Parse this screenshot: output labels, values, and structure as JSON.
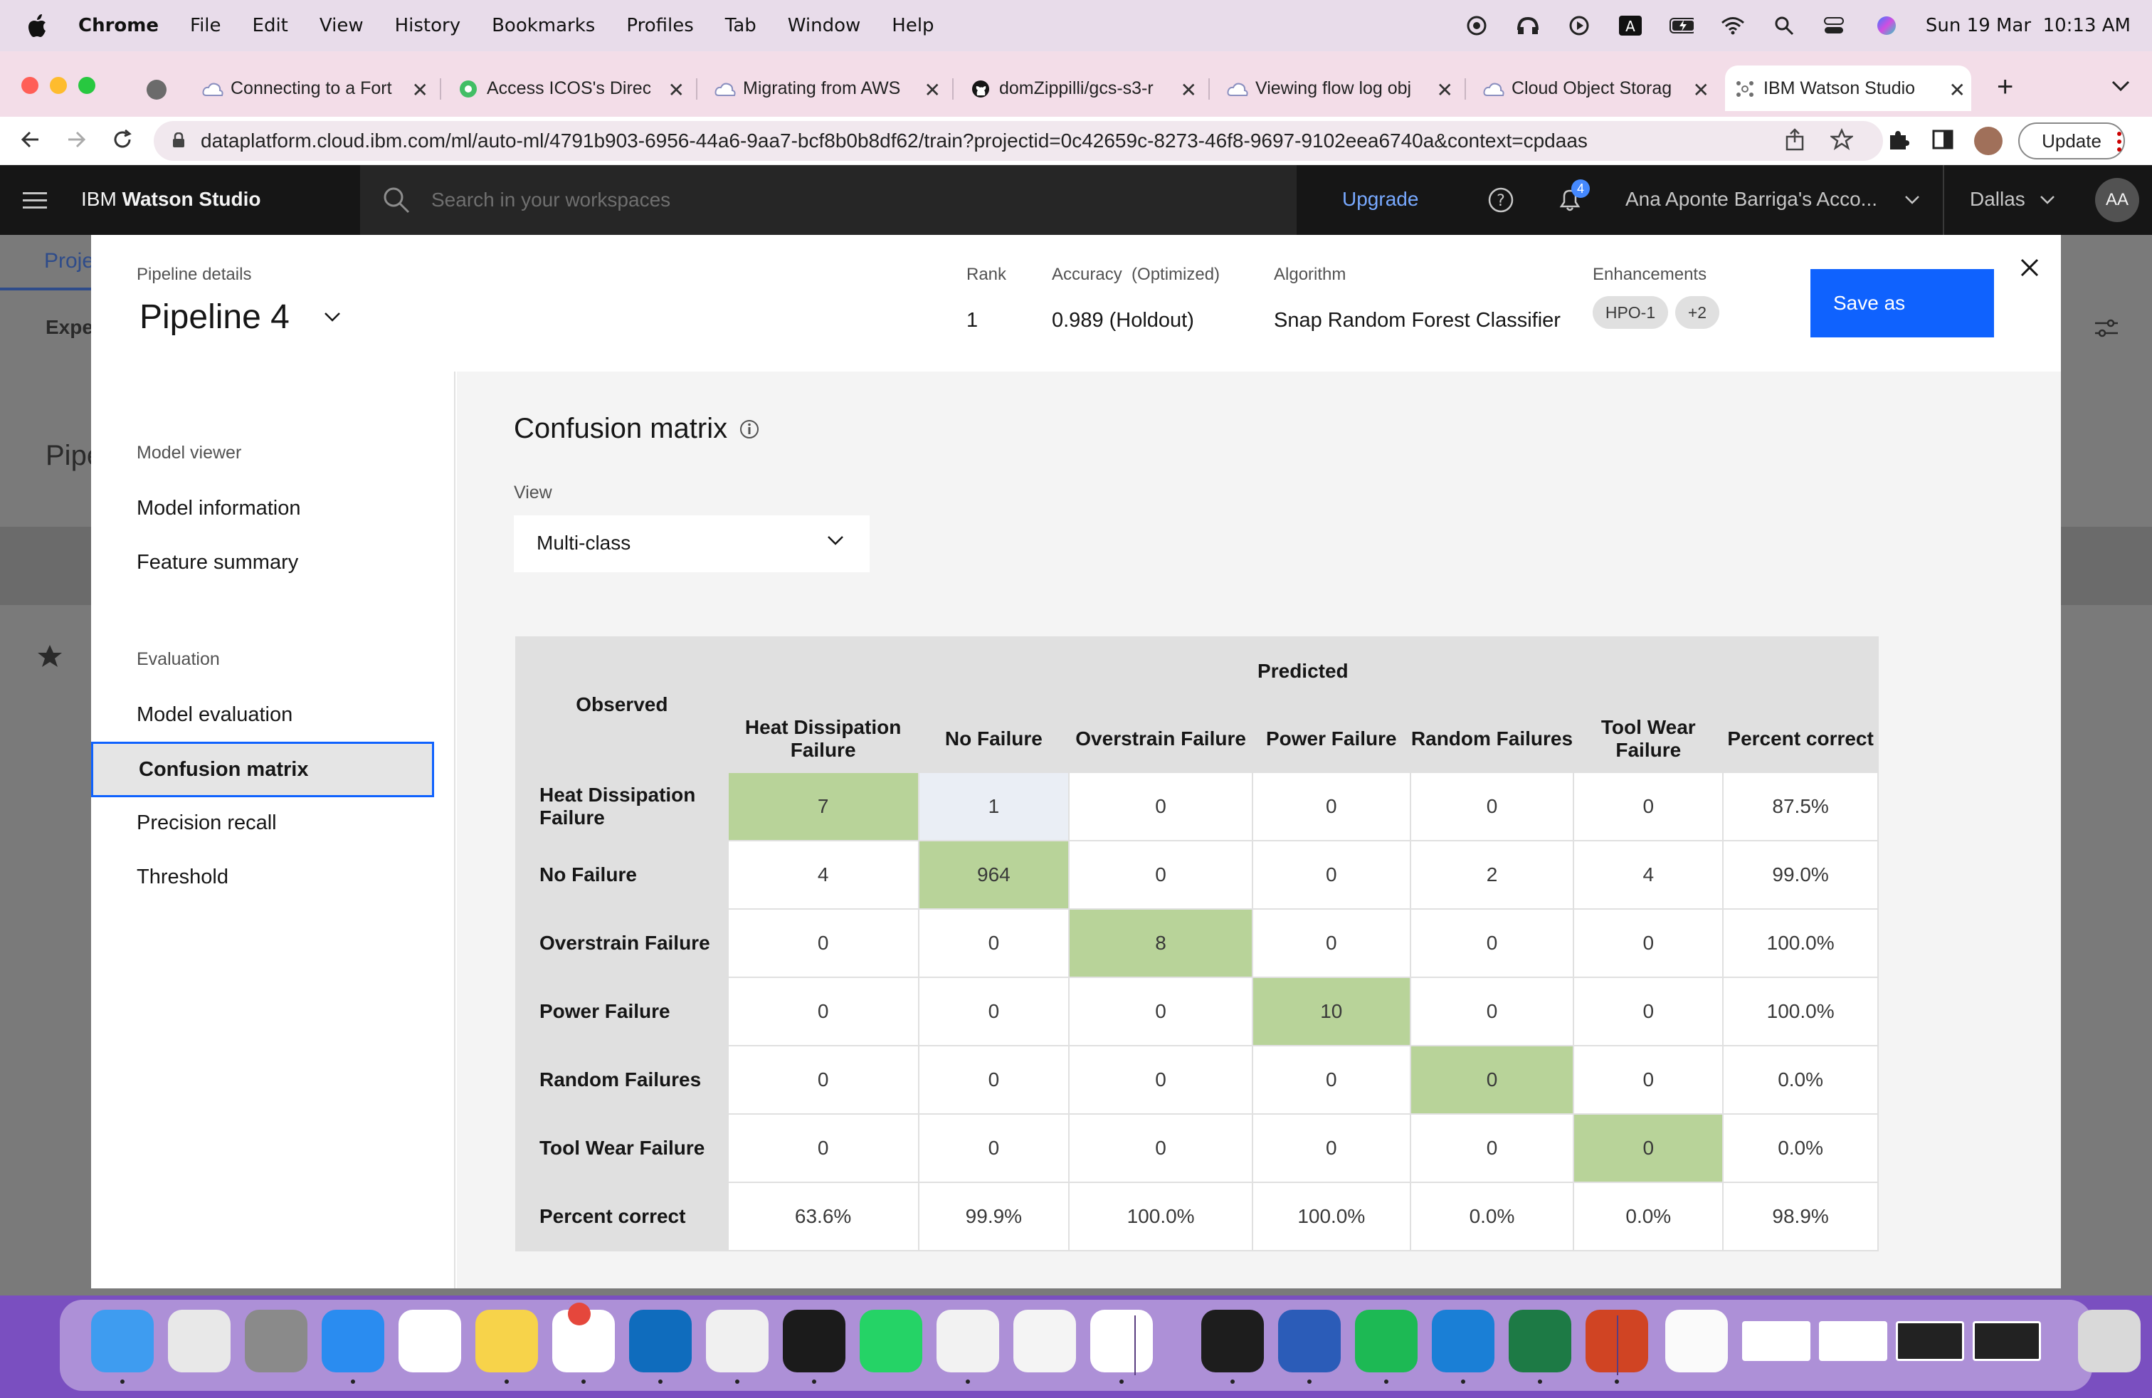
{
  "menubar": {
    "app": "Chrome",
    "items": [
      "File",
      "Edit",
      "View",
      "History",
      "Bookmarks",
      "Profiles",
      "Tab",
      "Window",
      "Help"
    ],
    "datetime": "Sun 19 Mar  10:13 AM",
    "status_icons": [
      "creative-cloud-icon",
      "bluetooth-headphones-icon",
      "play-icon",
      "keyboard-a-icon",
      "battery-charging-icon",
      "wifi-icon",
      "search-icon",
      "control-center-icon",
      "siri-icon"
    ]
  },
  "tabs": [
    {
      "title": "Connecting to a Fort",
      "icon": "cloud-icon"
    },
    {
      "title": "Access ICOS's Direc",
      "icon": "green-circle-icon"
    },
    {
      "title": "Migrating from AWS",
      "icon": "cloud-icon"
    },
    {
      "title": "domZippilli/gcs-s3-r",
      "icon": "github-icon"
    },
    {
      "title": "Viewing flow log obj",
      "icon": "cloud-icon"
    },
    {
      "title": "Cloud Object Storag",
      "icon": "cloud-icon"
    },
    {
      "title": "IBM Watson Studio",
      "icon": "watson-icon"
    }
  ],
  "address": {
    "url": "dataplatform.cloud.ibm.com/ml/auto-ml/4791b903-6956-44a6-9aa7-bcf8b0b8df62/train?projectid=0c42659c-8273-46f8-9697-9102eea6740a&context=cpdaas",
    "update_label": "Update"
  },
  "ws_header": {
    "brand_prefix": "IBM",
    "brand_name": "Watson Studio",
    "search_placeholder": "Search in your workspaces",
    "upgrade": "Upgrade",
    "notifications": "4",
    "account": "Ana Aponte Barriga's Acco...",
    "region": "Dallas",
    "avatar": "AA"
  },
  "backdrop": {
    "proj": "Proje",
    "expe": "Expe",
    "pipe": "Pipe"
  },
  "modal": {
    "details_label": "Pipeline details",
    "pipeline": "Pipeline 4",
    "rank_label": "Rank",
    "rank": "1",
    "accuracy_label": "Accuracy  (Optimized)",
    "accuracy": "0.989 (Holdout)",
    "algorithm_label": "Algorithm",
    "algorithm": "Snap Random Forest Classifier",
    "enhancements_label": "Enhancements",
    "enh_tag1": "HPO-1",
    "enh_tag2": "+2",
    "save_as": "Save as"
  },
  "sidenav": {
    "section1": "Model viewer",
    "model_information": "Model information",
    "feature_summary": "Feature summary",
    "section2": "Evaluation",
    "model_evaluation": "Model evaluation",
    "confusion_matrix": "Confusion matrix",
    "precision_recall": "Precision recall",
    "threshold": "Threshold"
  },
  "content": {
    "title": "Confusion matrix",
    "view_label": "View",
    "view_value": "Multi-class"
  },
  "matrix": {
    "observed": "Observed",
    "predicted": "Predicted",
    "columns": [
      "Heat Dissipation Failure",
      "No Failure",
      "Overstrain Failure",
      "Power Failure",
      "Random Failures",
      "Tool Wear Failure",
      "Percent correct"
    ],
    "rows": [
      {
        "label": "Heat Dissipation Failure",
        "cells": [
          "7",
          "1",
          "0",
          "0",
          "0",
          "0",
          "87.5%"
        ]
      },
      {
        "label": "No Failure",
        "cells": [
          "4",
          "964",
          "0",
          "0",
          "2",
          "4",
          "99.0%"
        ]
      },
      {
        "label": "Overstrain Failure",
        "cells": [
          "0",
          "0",
          "8",
          "0",
          "0",
          "0",
          "100.0%"
        ]
      },
      {
        "label": "Power Failure",
        "cells": [
          "0",
          "0",
          "0",
          "10",
          "0",
          "0",
          "100.0%"
        ]
      },
      {
        "label": "Random Failures",
        "cells": [
          "0",
          "0",
          "0",
          "0",
          "0",
          "0",
          "0.0%"
        ]
      },
      {
        "label": "Tool Wear Failure",
        "cells": [
          "0",
          "0",
          "0",
          "0",
          "0",
          "0",
          "0.0%"
        ]
      },
      {
        "label": "Percent correct",
        "cells": [
          "63.6%",
          "99.9%",
          "100.0%",
          "100.0%",
          "0.0%",
          "0.0%",
          "98.9%"
        ]
      }
    ],
    "colors": {
      "diagonal": "#b8d399",
      "off_diagonal_nonzero": "#eaeef5",
      "header": "#e0e0e0"
    }
  },
  "dock": {
    "apps": [
      "finder-icon",
      "launchpad-icon",
      "system-settings-icon",
      "safari-icon",
      "reminders-icon",
      "notes-icon",
      "slack-icon",
      "outlook-icon",
      "activity-icon",
      "terminal-icon",
      "whatsapp-icon",
      "chrome-icon",
      "script-editor-icon",
      "vscode-icon",
      "webex-icon",
      "word-icon",
      "spotify-icon",
      "edge-icon",
      "excel-icon",
      "powerpoint-icon",
      "document-icon",
      "thumbnail-1-icon",
      "thumbnail-2-icon",
      "thumbnail-3-icon",
      "thumbnail-4-icon",
      "trash-icon"
    ],
    "slack_badge": "1"
  }
}
